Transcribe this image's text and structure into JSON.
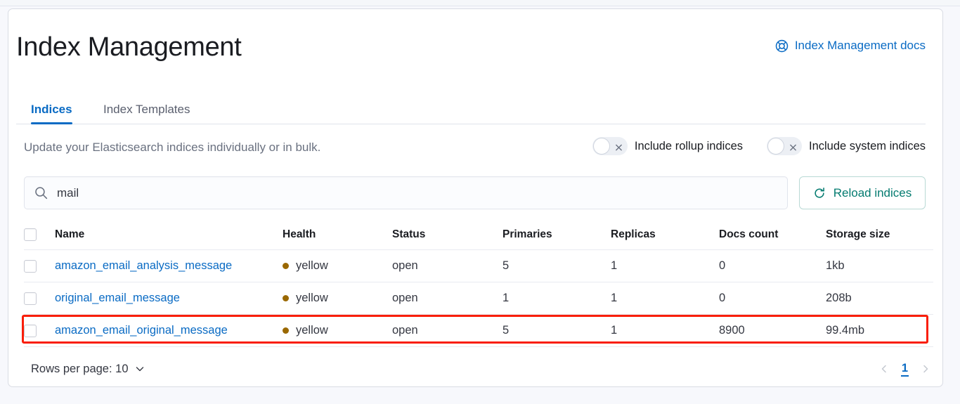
{
  "header": {
    "title": "Index Management",
    "docs_link": "Index Management docs",
    "docs_icon": "help-life-ring-icon"
  },
  "tabs": [
    {
      "label": "Indices",
      "active": true
    },
    {
      "label": "Index Templates",
      "active": false
    }
  ],
  "subheader": {
    "description": "Update your Elasticsearch indices individually or in bulk.",
    "switches": [
      {
        "label": "Include rollup indices",
        "on": false,
        "icon": "cross-icon"
      },
      {
        "label": "Include system indices",
        "on": false,
        "icon": "cross-icon"
      }
    ]
  },
  "search": {
    "icon": "search-icon",
    "value": "mail",
    "placeholder": "Search"
  },
  "reload_button": {
    "label": "Reload indices",
    "icon": "refresh-icon",
    "color": "#047b70"
  },
  "table": {
    "columns": [
      "Name",
      "Health",
      "Status",
      "Primaries",
      "Replicas",
      "Docs count",
      "Storage size"
    ],
    "rows": [
      {
        "name": "amazon_email_analysis_message",
        "health": "yellow",
        "health_color": "#9a6800",
        "status": "open",
        "primaries": "5",
        "replicas": "1",
        "docs_count": "0",
        "storage_size": "1kb",
        "highlighted": false
      },
      {
        "name": "original_email_message",
        "health": "yellow",
        "health_color": "#9a6800",
        "status": "open",
        "primaries": "1",
        "replicas": "1",
        "docs_count": "0",
        "storage_size": "208b",
        "highlighted": false
      },
      {
        "name": "amazon_email_original_message",
        "health": "yellow",
        "health_color": "#9a6800",
        "status": "open",
        "primaries": "5",
        "replicas": "1",
        "docs_count": "8900",
        "storage_size": "99.4mb",
        "highlighted": true
      }
    ]
  },
  "footer": {
    "rows_per_page_label": "Rows per page: 10",
    "rows_per_page_icon": "chevron-down-icon",
    "prev_icon": "chevron-left-icon",
    "next_icon": "chevron-right-icon",
    "current_page": "1"
  },
  "colors": {
    "accent_blue": "#0a6bc4",
    "accent_teal": "#047b70",
    "highlight_red": "#f91e07",
    "health_yellow": "#9a6800"
  }
}
